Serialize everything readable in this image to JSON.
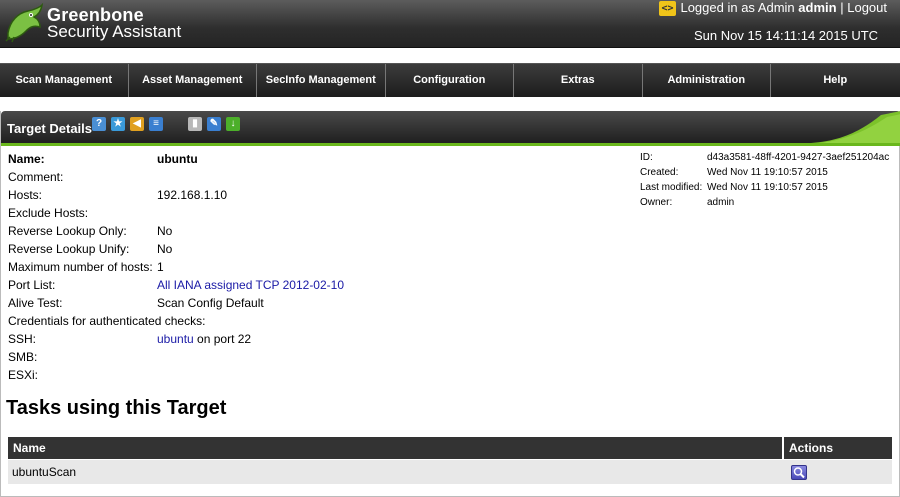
{
  "header": {
    "brand_line1": "Greenbone",
    "brand_line2": "Security Assistant",
    "lang_icon": "<>",
    "logged_in_prefix": "Logged in as Admin",
    "username": "admin",
    "separator": "|",
    "logout": "Logout",
    "datetime": "Sun Nov 15 14:11:14 2015 UTC"
  },
  "nav": [
    {
      "label": "Scan Management"
    },
    {
      "label": "Asset Management"
    },
    {
      "label": "SecInfo Management"
    },
    {
      "label": "Configuration"
    },
    {
      "label": "Extras"
    },
    {
      "label": "Administration"
    },
    {
      "label": "Help"
    }
  ],
  "panel": {
    "title": "Target Details",
    "icons": [
      "help-icon",
      "new-icon",
      "targets-list-icon",
      "list-icon",
      "trash-icon",
      "edit-icon",
      "export-icon"
    ]
  },
  "details": {
    "name_label": "Name:",
    "name_value": "ubuntu",
    "comment_label": "Comment:",
    "comment_value": "",
    "hosts_label": "Hosts:",
    "hosts_value": "192.168.1.10",
    "exclude_label": "Exclude Hosts:",
    "exclude_value": "",
    "rlo_label": "Reverse Lookup Only:",
    "rlo_value": "No",
    "rlu_label": "Reverse Lookup Unify:",
    "rlu_value": "No",
    "maxhosts_label": "Maximum number of hosts:",
    "maxhosts_value": "1",
    "portlist_label": "Port List:",
    "portlist_value": "All IANA assigned TCP 2012-02-10",
    "alive_label": "Alive Test:",
    "alive_value": "Scan Config Default",
    "creds_label": "Credentials for authenticated checks:",
    "ssh_label": "SSH:",
    "ssh_cred": "ubuntu",
    "ssh_port_text": "on port 22",
    "smb_label": "SMB:",
    "esxi_label": "ESXi:"
  },
  "meta": {
    "id_label": "ID:",
    "id_value": "d43a3581-48ff-4201-9427-3aef251204ac",
    "created_label": "Created:",
    "created_value": "Wed Nov 11 19:10:57 2015",
    "modified_label": "Last modified:",
    "modified_value": "Wed Nov 11 19:10:57 2015",
    "owner_label": "Owner:",
    "owner_value": "admin"
  },
  "tasks": {
    "title": "Tasks using this Target",
    "columns": {
      "name": "Name",
      "actions": "Actions"
    },
    "rows": [
      {
        "name": "ubuntuScan",
        "action_icon": "details-icon"
      }
    ]
  },
  "colors": {
    "accent_green": "#6ab71c",
    "link": "#1a1aa6",
    "header_dark": "#2e2e2e"
  }
}
